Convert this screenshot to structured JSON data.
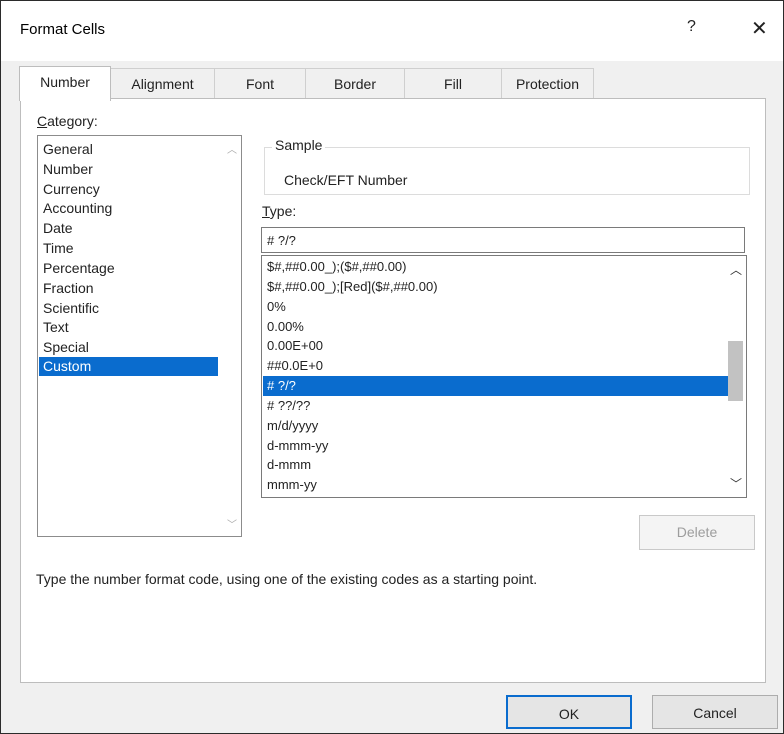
{
  "window": {
    "title": "Format Cells",
    "help_glyph": "?",
    "close_glyph": "✕"
  },
  "tabs": [
    {
      "label": "Number",
      "active": true
    },
    {
      "label": "Alignment",
      "active": false
    },
    {
      "label": "Font",
      "active": false
    },
    {
      "label": "Border",
      "active": false
    },
    {
      "label": "Fill",
      "active": false
    },
    {
      "label": "Protection",
      "active": false
    }
  ],
  "category": {
    "label_accel": "C",
    "label_rest": "ategory:",
    "items": [
      "General",
      "Number",
      "Currency",
      "Accounting",
      "Date",
      "Time",
      "Percentage",
      "Fraction",
      "Scientific",
      "Text",
      "Special",
      "Custom"
    ],
    "selected": "Custom"
  },
  "sample": {
    "legend": "Sample",
    "value": "Check/EFT Number"
  },
  "type": {
    "label_accel": "T",
    "label_rest": "ype:",
    "value": "# ?/?",
    "items": [
      "$#,##0.00_);($#,##0.00)",
      "$#,##0.00_);[Red]($#,##0.00)",
      "0%",
      "0.00%",
      "0.00E+00",
      "##0.0E+0",
      "# ?/?",
      "# ??/??",
      "m/d/yyyy",
      "d-mmm-yy",
      "d-mmm",
      "mmm-yy"
    ],
    "selected": "# ?/?"
  },
  "buttons": {
    "delete": "Delete",
    "ok": "OK",
    "cancel": "Cancel"
  },
  "hint": "Type the number format code, using one of the existing codes as a starting point.",
  "colors": {
    "selection": "#0a6cce",
    "ok_border": "#0a6cce"
  }
}
